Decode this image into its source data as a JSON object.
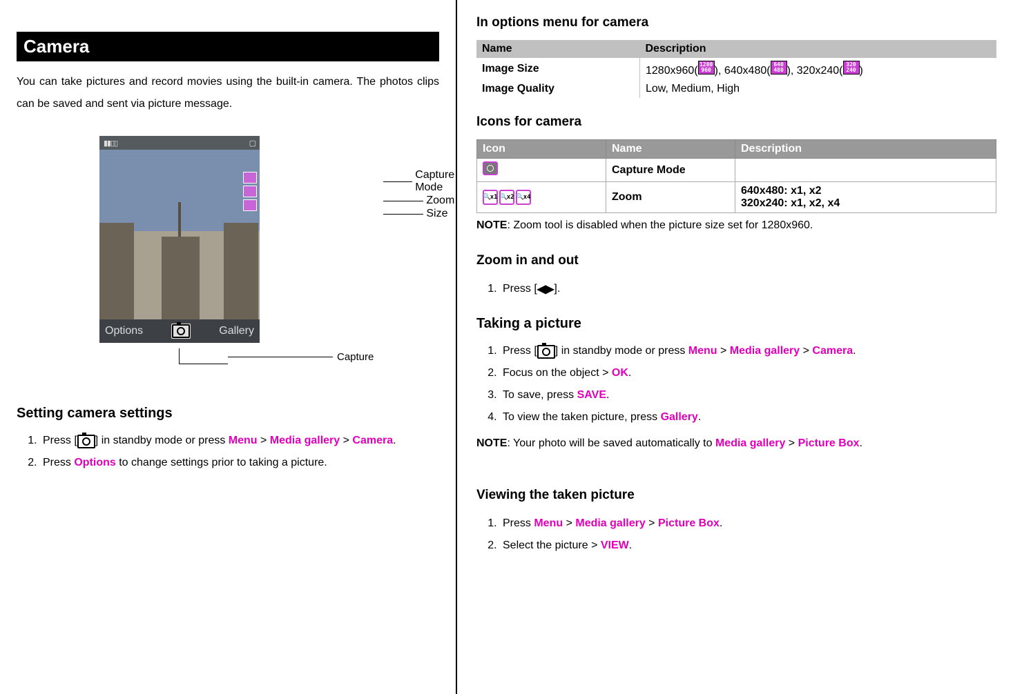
{
  "left": {
    "title": "Camera",
    "intro": "You can take pictures and record movies using the built-in camera. The photos clips can be saved and sent via picture message.",
    "phone": {
      "softkey_left": "Options",
      "softkey_right": "Gallery"
    },
    "callouts": {
      "capture_mode": "Capture Mode",
      "zoom": "Zoom",
      "size": "Size",
      "capture": "Capture"
    },
    "setting_heading": "Setting camera settings",
    "setting_steps": {
      "s1_a": "Press [",
      "s1_b": "] in standby mode or press ",
      "s1_menu": "Menu",
      "s1_gt1": " > ",
      "s1_media": "Media gallery",
      "s1_gt2": " > ",
      "s1_camera": "Camera",
      "s1_end": ".",
      "s2_a": "Press ",
      "s2_options": "Options",
      "s2_b": " to change settings prior to taking a picture."
    }
  },
  "right": {
    "options_heading": "In options menu for camera",
    "opts_table": {
      "h_name": "Name",
      "h_desc": "Description",
      "r1_name": "Image Size",
      "r1_v1": "1280x960(",
      "r1_b1a": "1280",
      "r1_b1b": "960",
      "r1_m1": "), 640x480(",
      "r1_b2a": "640",
      "r1_b2b": "480",
      "r1_m2": "), 320x240(",
      "r1_b3a": "320",
      "r1_b3b": "240",
      "r1_m3": ")",
      "r2_name": "Image Quality",
      "r2_desc": "Low, Medium, High"
    },
    "icons_heading": "Icons for camera",
    "icons_table": {
      "h_icon": "Icon",
      "h_name": "Name",
      "h_desc": "Description",
      "r1_name": "Capture Mode",
      "r2_name": "Zoom",
      "r2_desc_l1": "640x480: x1, x2",
      "r2_desc_l2": "320x240: x1, x2, x4"
    },
    "icons_note_a": "NOTE",
    "icons_note_b": ": Zoom tool is disabled when the picture size set for 1280x960.",
    "zoom_heading": "Zoom in and out",
    "zoom_step_a": "Press [",
    "zoom_arrows": "◀▶",
    "zoom_step_b": "].",
    "take_heading": "Taking a picture",
    "take": {
      "s1_a": "Press [",
      "s1_b": "] in standby mode or press ",
      "s1_menu": "Menu",
      "gt": " > ",
      "s1_media": "Media gallery",
      "s1_camera": "Camera",
      "s1_end": ".",
      "s2_a": "Focus on the object > ",
      "s2_ok": "OK",
      "s2_end": ".",
      "s3_a": "To save, press ",
      "s3_save": "SAVE",
      "s3_end": ".",
      "s4_a": "To view the taken picture, press ",
      "s4_gallery": "Gallery",
      "s4_end": "."
    },
    "take_note_a": "NOTE",
    "take_note_b": ": Your photo will be saved automatically to ",
    "take_note_media": "Media gallery",
    "take_note_gt": " > ",
    "take_note_pb": "Picture Box",
    "take_note_end": ".",
    "view_heading": "Viewing the taken picture",
    "view": {
      "s1_a": "Press ",
      "s1_menu": "Menu",
      "gt": " > ",
      "s1_media": "Media gallery",
      "s1_pb": "Picture Box",
      "s1_end": ".",
      "s2_a": "Select the picture > ",
      "s2_view": "VIEW",
      "s2_end": "."
    }
  }
}
